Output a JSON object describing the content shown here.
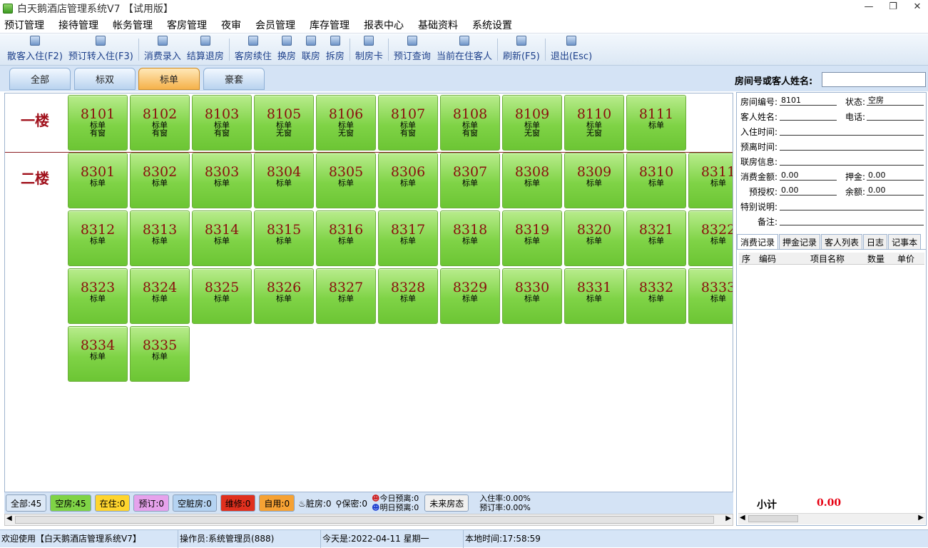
{
  "window": {
    "title": "白天鹅酒店管理系统V7 【试用版】"
  },
  "menu": [
    "预订管理",
    "接待管理",
    "帐务管理",
    "客房管理",
    "夜审",
    "会员管理",
    "库存管理",
    "报表中心",
    "基础资料",
    "系统设置"
  ],
  "toolbar": [
    {
      "label": "散客入住(F2)",
      "icon": "checkin-icon"
    },
    {
      "label": "预订转入住(F3)",
      "icon": "booking-convert-icon"
    },
    {
      "label": "消费录入",
      "icon": "consume-entry-icon"
    },
    {
      "label": "结算退房",
      "icon": "checkout-icon"
    },
    {
      "label": "客房续住",
      "icon": "extend-stay-icon"
    },
    {
      "label": "换房",
      "icon": "change-room-icon"
    },
    {
      "label": "联房",
      "icon": "link-room-icon"
    },
    {
      "label": "拆房",
      "icon": "split-room-icon"
    },
    {
      "label": "制房卡",
      "icon": "room-card-icon"
    },
    {
      "label": "预订查询",
      "icon": "booking-query-icon"
    },
    {
      "label": "当前在住客人",
      "icon": "current-guests-icon"
    },
    {
      "label": "刷新(F5)",
      "icon": "refresh-icon"
    },
    {
      "label": "退出(Esc)",
      "icon": "exit-icon"
    }
  ],
  "filter_tabs": [
    {
      "label": "全部"
    },
    {
      "label": "标双"
    },
    {
      "label": "标单",
      "selected": true
    },
    {
      "label": "豪套"
    }
  ],
  "search": {
    "label": "房间号或客人姓名:",
    "value": ""
  },
  "floors": [
    {
      "name": "一楼",
      "rooms": [
        {
          "no": "8101",
          "type": "标单",
          "note": "有窗"
        },
        {
          "no": "8102",
          "type": "标单",
          "note": "有窗"
        },
        {
          "no": "8103",
          "type": "标单",
          "note": "有窗"
        },
        {
          "no": "8105",
          "type": "标单",
          "note": "无窗"
        },
        {
          "no": "8106",
          "type": "标单",
          "note": "无窗"
        },
        {
          "no": "8107",
          "type": "标单",
          "note": "有窗"
        },
        {
          "no": "8108",
          "type": "标单",
          "note": "有窗"
        },
        {
          "no": "8109",
          "type": "标单",
          "note": "无窗"
        },
        {
          "no": "8110",
          "type": "标单",
          "note": "无窗"
        },
        {
          "no": "8111",
          "type": "标单",
          "note": ""
        }
      ]
    },
    {
      "name": "二楼",
      "rooms": [
        {
          "no": "8301",
          "type": "标单"
        },
        {
          "no": "8302",
          "type": "标单"
        },
        {
          "no": "8303",
          "type": "标单"
        },
        {
          "no": "8304",
          "type": "标单"
        },
        {
          "no": "8305",
          "type": "标单"
        },
        {
          "no": "8306",
          "type": "标单"
        },
        {
          "no": "8307",
          "type": "标单"
        },
        {
          "no": "8308",
          "type": "标单"
        },
        {
          "no": "8309",
          "type": "标单"
        },
        {
          "no": "8310",
          "type": "标单"
        },
        {
          "no": "8311",
          "type": "标单"
        },
        {
          "no": "8312",
          "type": "标单"
        },
        {
          "no": "8313",
          "type": "标单"
        },
        {
          "no": "8314",
          "type": "标单"
        },
        {
          "no": "8315",
          "type": "标单"
        },
        {
          "no": "8316",
          "type": "标单"
        },
        {
          "no": "8317",
          "type": "标单"
        },
        {
          "no": "8318",
          "type": "标单"
        },
        {
          "no": "8319",
          "type": "标单"
        },
        {
          "no": "8320",
          "type": "标单"
        },
        {
          "no": "8321",
          "type": "标单"
        },
        {
          "no": "8322",
          "type": "标单"
        },
        {
          "no": "8323",
          "type": "标单"
        },
        {
          "no": "8324",
          "type": "标单"
        },
        {
          "no": "8325",
          "type": "标单"
        },
        {
          "no": "8326",
          "type": "标单"
        },
        {
          "no": "8327",
          "type": "标单"
        },
        {
          "no": "8328",
          "type": "标单"
        },
        {
          "no": "8329",
          "type": "标单"
        },
        {
          "no": "8330",
          "type": "标单"
        },
        {
          "no": "8331",
          "type": "标单"
        },
        {
          "no": "8332",
          "type": "标单"
        },
        {
          "no": "8333",
          "type": "标单"
        },
        {
          "no": "8334",
          "type": "标单"
        },
        {
          "no": "8335",
          "type": "标单"
        }
      ]
    }
  ],
  "room_info": {
    "room_no_label": "房间编号:",
    "room_no": "8101",
    "status_label": "状态:",
    "status": "空房",
    "guest_label": "客人姓名:",
    "guest": "",
    "phone_label": "电话:",
    "phone": "",
    "checkin_label": "入住时间:",
    "checkin": "",
    "leave_label": "预离时间:",
    "leave": "",
    "link_label": "联房信息:",
    "link": "",
    "amount_label": "消费金额:",
    "amount": "0.00",
    "deposit_label": "押金:",
    "deposit": "0.00",
    "preauth_label": "预授权:",
    "preauth": "0.00",
    "balance_label": "余额:",
    "balance": "0.00",
    "special_label": "特别说明:",
    "special": "",
    "remark_label": "备注:",
    "remark": ""
  },
  "right_tabs": [
    {
      "label": "消费记录",
      "selected": true
    },
    {
      "label": "押金记录"
    },
    {
      "label": "客人列表"
    },
    {
      "label": "日志"
    },
    {
      "label": "记事本"
    }
  ],
  "records_table": {
    "columns": [
      "序",
      "编码",
      "项目名称",
      "数量",
      "单价"
    ]
  },
  "subtotal": {
    "label": "小计",
    "value": "0.00"
  },
  "status_counts": [
    {
      "label": "全部:45",
      "color": "#dce8f6"
    },
    {
      "label": "空房:45",
      "color": "#7fd346"
    },
    {
      "label": "在住:0",
      "color": "#ffd52e"
    },
    {
      "label": "预订:0",
      "color": "#e6a2ec"
    },
    {
      "label": "空脏房:0",
      "color": "#b5d3f2"
    },
    {
      "label": "维修:0",
      "color": "#e0301e"
    },
    {
      "label": "自用:0",
      "color": "#f6a234"
    }
  ],
  "status_text": {
    "dirty": "脏房:0",
    "secret": "保密:0",
    "today_leave": "今日预离:0",
    "tomorrow_leave": "明日预离:0",
    "future": "未来房态",
    "occupancy": "入住率:0.00%",
    "booking_rate": "预订率:0.00%"
  },
  "bottom_bar": {
    "welcome": "欢迎使用【白天鹅酒店管理系统V7】",
    "operator": "操作员:系统管理员(888)",
    "today": "今天是:2022-04-11 星期一",
    "time": "本地时间:17:58:59"
  },
  "colors": {
    "room_bg": "#7fd346",
    "room_number": "#8a0e0e",
    "floor_label": "#a0101b",
    "subtotal_value": "#e60012"
  }
}
